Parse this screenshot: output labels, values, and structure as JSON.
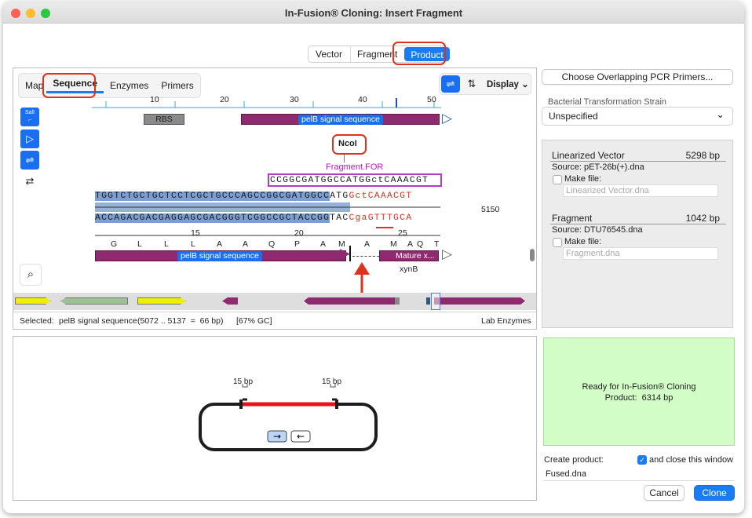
{
  "window": {
    "title": "In-Fusion® Cloning: Insert Fragment"
  },
  "top_tabs": [
    "Vector",
    "Fragment",
    "Product"
  ],
  "seq_panel": {
    "tabs": [
      "Map",
      "Sequence",
      "Enzymes",
      "Primers"
    ],
    "display_label": "Display",
    "ruler": [
      "10",
      "20",
      "30",
      "40",
      "50"
    ],
    "features": {
      "rbs": "RBS",
      "pelb_top": "pelB signal sequence",
      "pelb_bottom": "pelB signal sequence",
      "mature": "Mature x...",
      "xynb": "xynB"
    },
    "ncoi": "NcoI",
    "sali": "SalI",
    "primer_name": "Fragment.FOR",
    "primer_seq": "CCGGCGATGGCCATGGctCAAACGT",
    "top_seq_a": "TGGTCTGCTGCTCCTCGCTGCCCAGCCGGCGATGGCC",
    "top_seq_b": "ATG",
    "top_seq_c": "GctCAAACGT",
    "bot_seq_a": "ACCAGACGACGAGGAGCGACGGGTCGGCCGCTACCGG",
    "bot_seq_b": "TAC",
    "bot_seq_c": "CgaGTTTGCA",
    "position": "5150",
    "aa_numbers": [
      "15",
      "20",
      "25"
    ],
    "amino_acids": [
      "G",
      "L",
      "L",
      "L",
      "A",
      "A",
      "Q",
      "P",
      "A",
      "M",
      "A",
      "M",
      "A",
      "Q",
      "T"
    ]
  },
  "status": {
    "selected_label": "Selected:",
    "selected_name": "pelB signal sequence",
    "range": "(5072 .. 5137  =  66 bp)",
    "gc": "[67% GC]",
    "enzymes": "Lab Enzymes"
  },
  "diagram": {
    "left_bp": "15 bp",
    "right_bp": "15 bp"
  },
  "right_panel": {
    "primers_button": "Choose Overlapping PCR Primers...",
    "strain_label": "Bacterial Transformation Strain",
    "strain_value": "Unspecified",
    "vector_title": "Linearized Vector",
    "vector_bp": "5298 bp",
    "vector_source": "Source:  pET-26b(+).dna",
    "vector_make": "Make file:",
    "vector_file": "Linearized Vector.dna",
    "frag_title": "Fragment",
    "frag_bp": "1042 bp",
    "frag_source": "Source:  DTU76545.dna",
    "frag_make": "Make file:",
    "frag_file": "Fragment.dna",
    "ready_line1": "Ready for In-Fusion® Cloning",
    "ready_line2": "Product:  6314 bp",
    "create_label": "Create product:",
    "close_label": "and close this window",
    "product_name": "Fused.dna",
    "cancel": "Cancel",
    "clone": "Clone"
  }
}
